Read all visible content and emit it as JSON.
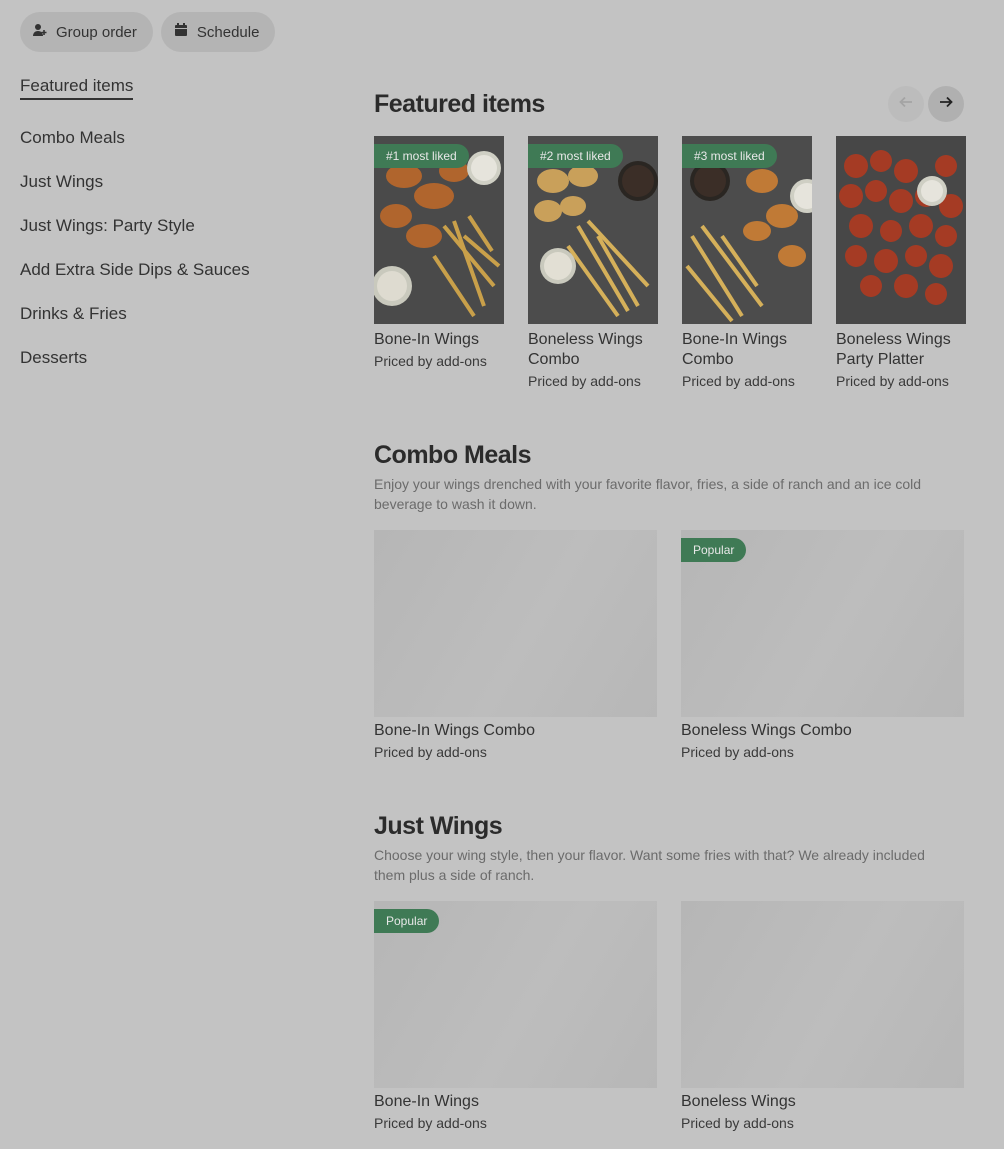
{
  "top_buttons": {
    "group_order": "Group order",
    "schedule": "Schedule"
  },
  "sidebar": {
    "items": [
      {
        "label": "Featured items",
        "active": true
      },
      {
        "label": "Combo Meals"
      },
      {
        "label": "Just Wings"
      },
      {
        "label": "Just Wings: Party Style"
      },
      {
        "label": "Add Extra Side Dips & Sauces"
      },
      {
        "label": "Drinks & Fries"
      },
      {
        "label": "Desserts"
      }
    ]
  },
  "featured": {
    "title": "Featured items",
    "items": [
      {
        "badge": "#1 most liked",
        "name": "Bone-In Wings",
        "price": "Priced by add-ons"
      },
      {
        "badge": "#2 most liked",
        "name": "Boneless Wings Combo",
        "price": "Priced by add-ons"
      },
      {
        "badge": "#3 most liked",
        "name": "Bone-In Wings Combo",
        "price": "Priced by add-ons"
      },
      {
        "name": "Boneless Wings Party Platter",
        "price": "Priced by add-ons"
      }
    ]
  },
  "combo_meals": {
    "title": "Combo Meals",
    "description": "Enjoy your wings drenched with your favorite flavor, fries, a side of ranch and an ice cold beverage to wash it down.",
    "items": [
      {
        "name": "Bone-In Wings Combo",
        "price": "Priced by add-ons"
      },
      {
        "badge": "Popular",
        "name": "Boneless Wings Combo",
        "price": "Priced by add-ons"
      }
    ]
  },
  "just_wings": {
    "title": "Just Wings",
    "description": "Choose your wing style, then your flavor. Want some fries with that? We already included them plus a side of ranch.",
    "items": [
      {
        "badge": "Popular",
        "name": "Bone-In Wings",
        "price": "Priced by add-ons"
      },
      {
        "name": "Boneless Wings",
        "price": "Priced by add-ons"
      }
    ]
  },
  "colors": {
    "background": "#c3c3c3",
    "badge": "#3f7a55"
  }
}
